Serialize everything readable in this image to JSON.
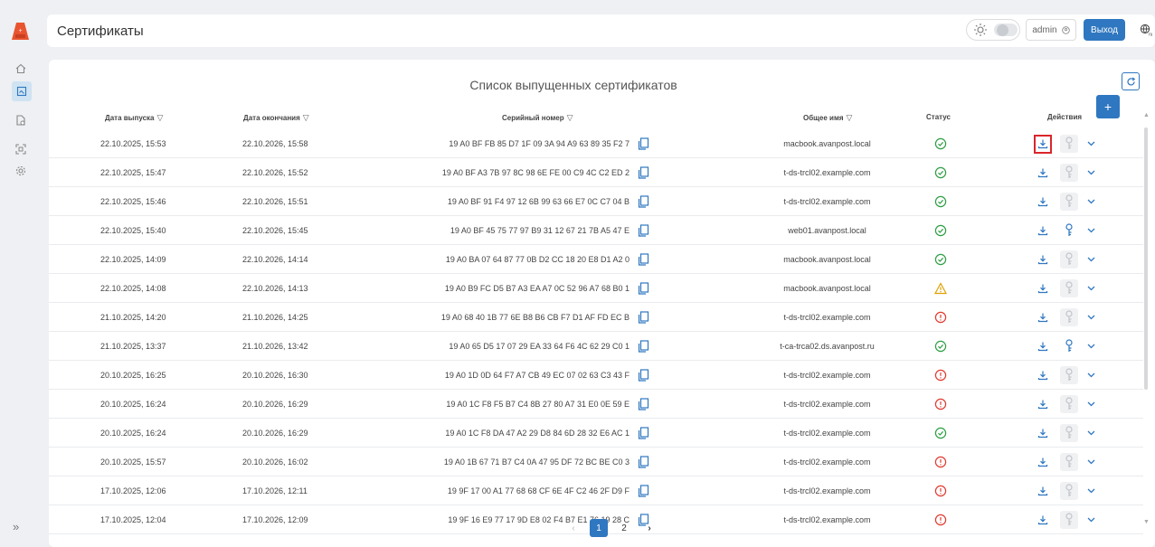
{
  "app": {
    "title": "Сертификаты",
    "user_label": "admin",
    "logout_label": "Выход",
    "accent": "#2f77c0"
  },
  "sidebar": {
    "items": [
      {
        "icon": "home-icon"
      },
      {
        "icon": "certificates-icon",
        "active": true
      },
      {
        "icon": "document-settings-icon"
      },
      {
        "icon": "scan-icon"
      },
      {
        "icon": "gear-icon"
      }
    ],
    "expand_label": "»"
  },
  "list": {
    "title": "Список выпущенных сертификатов",
    "add_label": "+",
    "refresh_label": "⟳",
    "columns": {
      "issue_date": "Дата выпуска",
      "end_date": "Дата окончания",
      "serial": "Серийный номер",
      "common_name": "Общее имя",
      "status": "Статус",
      "actions": "Действия"
    },
    "rows": [
      {
        "issue": "22.10.2025, 15:53",
        "end": "22.10.2026, 15:58",
        "serial": "19 A0 BF FB 85 D7 1F 09 3A 94 A9 63 89 35 F2 7",
        "cn": "macbook.avanpost.local",
        "status": "ok",
        "key_enabled": false,
        "highlight": true
      },
      {
        "issue": "22.10.2025, 15:47",
        "end": "22.10.2026, 15:52",
        "serial": "19 A0 BF A3 7B 97 8C 98 6E FE 00 C9 4C C2 ED 2",
        "cn": "t-ds-trcl02.example.com",
        "status": "ok",
        "key_enabled": false
      },
      {
        "issue": "22.10.2025, 15:46",
        "end": "22.10.2026, 15:51",
        "serial": "19 A0 BF 91 F4 97 12 6B 99 63 66 E7 0C C7 04 B",
        "cn": "t-ds-trcl02.example.com",
        "status": "ok",
        "key_enabled": false
      },
      {
        "issue": "22.10.2025, 15:40",
        "end": "22.10.2026, 15:45",
        "serial": "19 A0 BF 45 75 77 97 B9 31 12 67 21 7B A5 47 E",
        "cn": "web01.avanpost.local",
        "status": "ok",
        "key_enabled": true
      },
      {
        "issue": "22.10.2025, 14:09",
        "end": "22.10.2026, 14:14",
        "serial": "19 A0 BA 07 64 87 77 0B D2 CC 18 20 E8 D1 A2 0",
        "cn": "macbook.avanpost.local",
        "status": "ok",
        "key_enabled": false
      },
      {
        "issue": "22.10.2025, 14:08",
        "end": "22.10.2026, 14:13",
        "serial": "19 A0 B9 FC D5 B7 A3 EA A7 0C 52 96 A7 68 B0 1",
        "cn": "macbook.avanpost.local",
        "status": "warning",
        "key_enabled": false
      },
      {
        "issue": "21.10.2025, 14:20",
        "end": "21.10.2026, 14:25",
        "serial": "19 A0 68 40 1B 77 6E B8 B6 CB F7 D1 AF FD EC B",
        "cn": "t-ds-trcl02.example.com",
        "status": "error",
        "key_enabled": false
      },
      {
        "issue": "21.10.2025, 13:37",
        "end": "21.10.2026, 13:42",
        "serial": "19 A0 65 D5 17 07 29 EA 33 64 F6 4C 62 29 C0 1",
        "cn": "t-ca-trca02.ds.avanpost.ru",
        "status": "ok",
        "key_enabled": true
      },
      {
        "issue": "20.10.2025, 16:25",
        "end": "20.10.2026, 16:30",
        "serial": "19 A0 1D 0D 64 F7 A7 CB 49 EC 07 02 63 C3 43 F",
        "cn": "t-ds-trcl02.example.com",
        "status": "error",
        "key_enabled": false
      },
      {
        "issue": "20.10.2025, 16:24",
        "end": "20.10.2026, 16:29",
        "serial": "19 A0 1C F8 F5 B7 C4 8B 27 80 A7 31 E0 0E 59 E",
        "cn": "t-ds-trcl02.example.com",
        "status": "error",
        "key_enabled": false
      },
      {
        "issue": "20.10.2025, 16:24",
        "end": "20.10.2026, 16:29",
        "serial": "19 A0 1C F8 DA 47 A2 29 D8 84 6D 28 32 E6 AC 1",
        "cn": "t-ds-trcl02.example.com",
        "status": "ok",
        "key_enabled": false
      },
      {
        "issue": "20.10.2025, 15:57",
        "end": "20.10.2026, 16:02",
        "serial": "19 A0 1B 67 71 B7 C4 0A 47 95 DF 72 BC BE C0 3",
        "cn": "t-ds-trcl02.example.com",
        "status": "error",
        "key_enabled": false
      },
      {
        "issue": "17.10.2025, 12:06",
        "end": "17.10.2026, 12:11",
        "serial": "19 9F 17 00 A1 77 68 68 CF 6E 4F C2 46 2F D9 F",
        "cn": "t-ds-trcl02.example.com",
        "status": "error",
        "key_enabled": false
      },
      {
        "issue": "17.10.2025, 12:04",
        "end": "17.10.2026, 12:09",
        "serial": "19 9F 16 E9 77 17 9D E8 02 F4 B7 E1 76 19 28 C",
        "cn": "t-ds-trcl02.example.com",
        "status": "error",
        "key_enabled": false
      }
    ]
  },
  "pagination": {
    "pages": [
      "1",
      "2"
    ],
    "current": "1"
  }
}
